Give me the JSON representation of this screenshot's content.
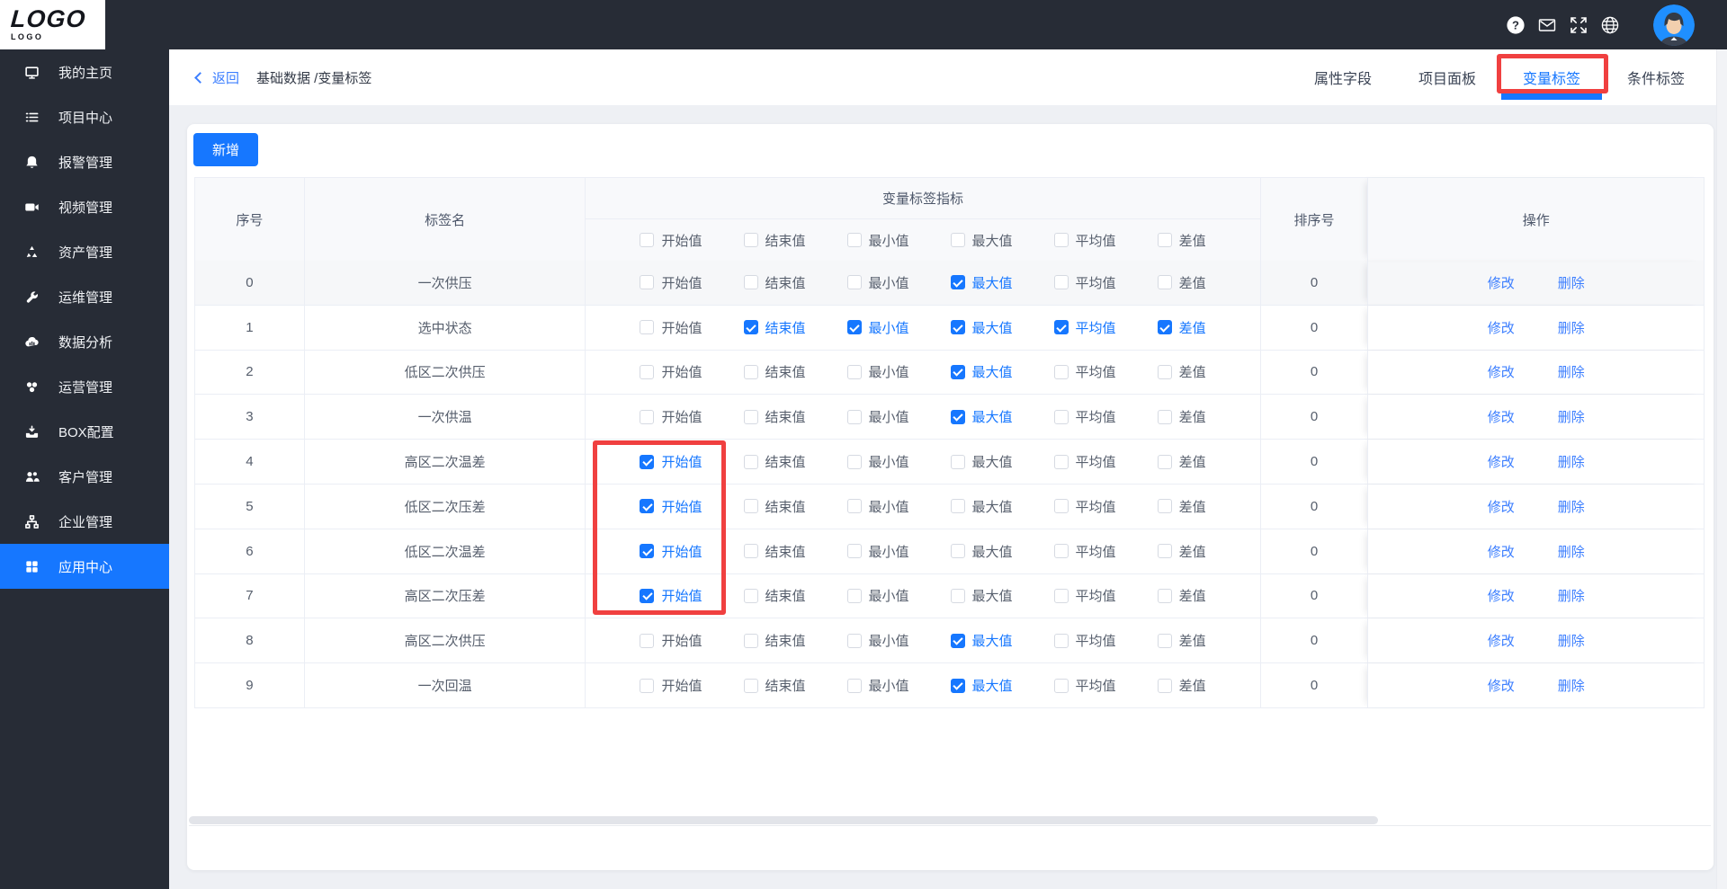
{
  "colors": {
    "accent": "#1677ff",
    "link": "#3d7fff",
    "annotation_red": "#f04040",
    "topbar_bg": "#272c36",
    "page_bg": "#eef0f4",
    "row_stripe": "#f6f7f9",
    "table_header_bg": "#f8f9fb",
    "border": "#ebeef5"
  },
  "topbar": {
    "logo_line1": "LOGO",
    "logo_line2": "L O G O",
    "icons": [
      {
        "name": "help-icon"
      },
      {
        "name": "mail-icon"
      },
      {
        "name": "fullscreen-icon"
      },
      {
        "name": "globe-icon"
      }
    ],
    "avatar": {
      "name": "user-avatar"
    }
  },
  "sidebar": {
    "items": [
      {
        "label": "我的主页",
        "icon": "monitor-icon",
        "active": false
      },
      {
        "label": "项目中心",
        "icon": "list-icon",
        "active": false
      },
      {
        "label": "报警管理",
        "icon": "bell-icon",
        "active": false
      },
      {
        "label": "视频管理",
        "icon": "video-icon",
        "active": false
      },
      {
        "label": "资产管理",
        "icon": "recycle-icon",
        "active": false
      },
      {
        "label": "运维管理",
        "icon": "wrench-icon",
        "active": false
      },
      {
        "label": "数据分析",
        "icon": "cloud-chart-icon",
        "active": false
      },
      {
        "label": "运营管理",
        "icon": "circles-icon",
        "active": false
      },
      {
        "label": "BOX配置",
        "icon": "inbox-icon",
        "active": false
      },
      {
        "label": "客户管理",
        "icon": "users-icon",
        "active": false
      },
      {
        "label": "企业管理",
        "icon": "org-icon",
        "active": false
      },
      {
        "label": "应用中心",
        "icon": "grid-icon",
        "active": true
      }
    ]
  },
  "header": {
    "back_label": "返回",
    "breadcrumb": "基础数据 /变量标签",
    "tabs": [
      {
        "label": "属性字段",
        "active": false
      },
      {
        "label": "项目面板",
        "active": false
      },
      {
        "label": "变量标签",
        "active": true
      },
      {
        "label": "条件标签",
        "active": false
      }
    ]
  },
  "toolbar": {
    "add_label": "新增"
  },
  "table": {
    "columns": {
      "seq": "序号",
      "name": "标签名",
      "metrics_group": "变量标签指标",
      "sort": "排序号",
      "actions": "操作"
    },
    "metric_labels": [
      "开始值",
      "结束值",
      "最小值",
      "最大值",
      "平均值",
      "差值"
    ],
    "action_labels": {
      "modify": "修改",
      "delete": "删除"
    },
    "rows": [
      {
        "seq": "0",
        "name": "一次供压",
        "checks": [
          false,
          false,
          false,
          true,
          false,
          false
        ],
        "sort": "0"
      },
      {
        "seq": "1",
        "name": "选中状态",
        "checks": [
          false,
          true,
          true,
          true,
          true,
          true
        ],
        "sort": "0"
      },
      {
        "seq": "2",
        "name": "低区二次供压",
        "checks": [
          false,
          false,
          false,
          true,
          false,
          false
        ],
        "sort": "0"
      },
      {
        "seq": "3",
        "name": "一次供温",
        "checks": [
          false,
          false,
          false,
          true,
          false,
          false
        ],
        "sort": "0"
      },
      {
        "seq": "4",
        "name": "高区二次温差",
        "checks": [
          true,
          false,
          false,
          false,
          false,
          false
        ],
        "sort": "0"
      },
      {
        "seq": "5",
        "name": "低区二次压差",
        "checks": [
          true,
          false,
          false,
          false,
          false,
          false
        ],
        "sort": "0"
      },
      {
        "seq": "6",
        "name": "低区二次温差",
        "checks": [
          true,
          false,
          false,
          false,
          false,
          false
        ],
        "sort": "0"
      },
      {
        "seq": "7",
        "name": "高区二次压差",
        "checks": [
          true,
          false,
          false,
          false,
          false,
          false
        ],
        "sort": "0"
      },
      {
        "seq": "8",
        "name": "高区二次供压",
        "checks": [
          false,
          false,
          false,
          true,
          false,
          false
        ],
        "sort": "0"
      },
      {
        "seq": "9",
        "name": "一次回温",
        "checks": [
          false,
          false,
          false,
          true,
          false,
          false
        ],
        "sort": "0"
      }
    ]
  },
  "annotations": {
    "tab_box": "highlight-active-tab",
    "rows_box": "highlight-start-value-rows-4-to-7"
  }
}
